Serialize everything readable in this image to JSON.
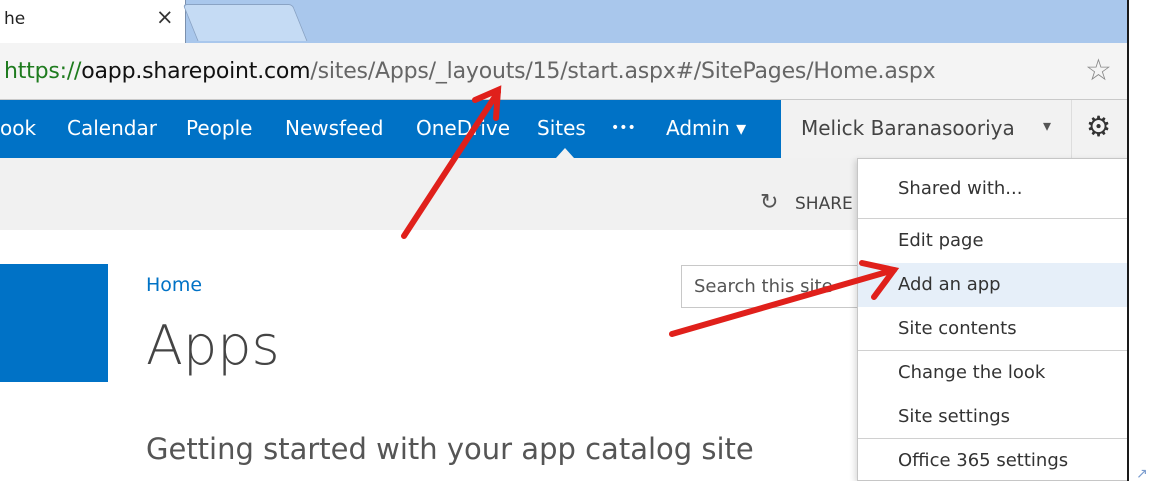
{
  "browser": {
    "tab_title": "he",
    "tab_close": "×",
    "url_scheme": "https://",
    "url_host": "oapp.sharepoint.com",
    "url_path": "/sites/Apps/_layouts/15/start.aspx#/SitePages/Home.aspx",
    "star_icon": "☆"
  },
  "suitebar": {
    "items": [
      "ook",
      "Calendar",
      "People",
      "Newsfeed",
      "OneDrive",
      "Sites",
      "•••",
      "Admin ▾"
    ],
    "active": "Sites",
    "user_name": "Melick Baranasooriya",
    "user_caret": "▾",
    "gear_icon": "⚙",
    "brand_color": "#0072c6"
  },
  "ribbon": {
    "share_icon": "↻",
    "share_label": "SHARE"
  },
  "page": {
    "breadcrumb": "Home",
    "title": "Apps",
    "search_placeholder": "Search this site",
    "getting_started": "Getting started with your app catalog site"
  },
  "settings_menu": {
    "items": [
      "Shared with...",
      "Edit page",
      "Add an app",
      "Site contents",
      "Change the look",
      "Site settings",
      "Office 365 settings"
    ],
    "highlighted": "Add an app"
  },
  "annotation_color": "#e0201b"
}
